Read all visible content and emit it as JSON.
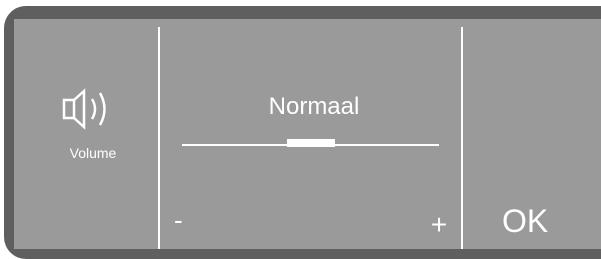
{
  "volume": {
    "icon": "speaker-icon",
    "label": "Volume"
  },
  "setting": {
    "value_label": "Normaal",
    "level": 0.5
  },
  "controls": {
    "minus_label": "-",
    "plus_label": "+",
    "ok_label": "OK"
  },
  "colors": {
    "screen": "#9a9a9a",
    "frame": "#5f5f5f",
    "foreground": "#ffffff"
  }
}
